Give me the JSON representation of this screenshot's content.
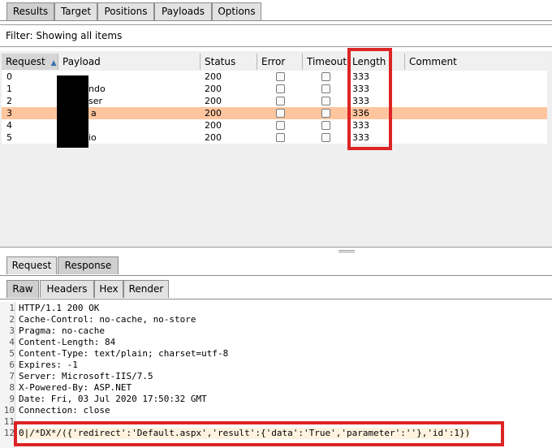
{
  "top_tabs": [
    "Results",
    "Target",
    "Positions",
    "Payloads",
    "Options"
  ],
  "filter": {
    "label": "Filter:",
    "text": "Showing all items"
  },
  "columns": [
    "Request",
    "Payload",
    "Status",
    "Error",
    "Timeout",
    "Length",
    "Comment"
  ],
  "sort_indicator": "▲",
  "rows": [
    {
      "request": "0",
      "payload": "",
      "status": "200",
      "length": "333"
    },
    {
      "request": "1",
      "payload": "ndo",
      "status": "200",
      "length": "333"
    },
    {
      "request": "2",
      "payload": "ser",
      "status": "200",
      "length": "333"
    },
    {
      "request": "3",
      "payload": "a",
      "status": "200",
      "length": "336"
    },
    {
      "request": "4",
      "payload": "",
      "status": "200",
      "length": "333"
    },
    {
      "request": "5",
      "payload": "io",
      "status": "200",
      "length": "333"
    }
  ],
  "selected_row": "3",
  "highlight_color": "#ffc59f",
  "annotation_color": "#dd2424",
  "req_resp_tabs": [
    "Request",
    "Response"
  ],
  "view_tabs": [
    "Raw",
    "Headers",
    "Hex",
    "Render"
  ],
  "response_lines": [
    "HTTP/1.1 200 OK",
    "Cache-Control: no-cache, no-store",
    "Pragma: no-cache",
    "Content-Length: 84",
    "Content-Type: text/plain; charset=utf-8",
    "Expires: -1",
    "Server: Microsoft-IIS/7.5",
    "X-Powered-By: ASP.NET",
    "Date: Fri, 03 Jul 2020 17:50:32 GMT",
    "Connection: close",
    "",
    "0|/*DX*/({'redirect':'Default.aspx','result':{'data':'True','parameter':''},'id':1})"
  ],
  "line_numbers": [
    "1",
    "2",
    "3",
    "4",
    "5",
    "6",
    "7",
    "8",
    "9",
    "10",
    "11",
    "12"
  ]
}
